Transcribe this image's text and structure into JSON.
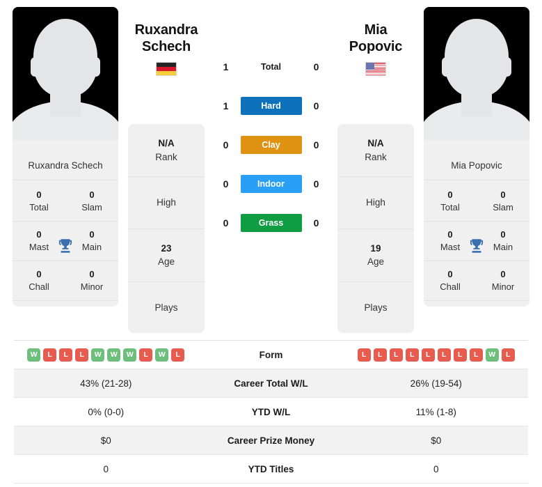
{
  "players": {
    "left": {
      "name": "Ruxandra Schech",
      "first_name": "Ruxandra",
      "last_name": "Schech",
      "country_flag": "germany-flag",
      "rank": "N/A",
      "rank_label": "Rank",
      "high_label": "High",
      "high_value": "",
      "age": "23",
      "age_label": "Age",
      "plays_label": "Plays",
      "plays_value": "",
      "titles": [
        {
          "value": "0",
          "label": "Total"
        },
        {
          "value": "0",
          "label": "Slam"
        },
        {
          "value": "0",
          "label": "Mast"
        },
        {
          "value": "0",
          "label": "Main"
        },
        {
          "value": "0",
          "label": "Chall"
        },
        {
          "value": "0",
          "label": "Minor"
        }
      ],
      "form": [
        "W",
        "L",
        "L",
        "L",
        "W",
        "W",
        "W",
        "L",
        "W",
        "L"
      ],
      "career_total_wl": "43% (21-28)",
      "ytd_wl": "0% (0-0)",
      "career_prize_money": "$0",
      "ytd_titles": "0"
    },
    "right": {
      "name": "Mia Popovic",
      "first_name": "Mia",
      "last_name": "Popovic",
      "country_flag": "usa-flag",
      "rank": "N/A",
      "rank_label": "Rank",
      "high_label": "High",
      "high_value": "",
      "age": "19",
      "age_label": "Age",
      "plays_label": "Plays",
      "plays_value": "",
      "titles": [
        {
          "value": "0",
          "label": "Total"
        },
        {
          "value": "0",
          "label": "Slam"
        },
        {
          "value": "0",
          "label": "Mast"
        },
        {
          "value": "0",
          "label": "Main"
        },
        {
          "value": "0",
          "label": "Chall"
        },
        {
          "value": "0",
          "label": "Minor"
        }
      ],
      "form": [
        "L",
        "L",
        "L",
        "L",
        "L",
        "L",
        "L",
        "L",
        "W",
        "L"
      ],
      "career_total_wl": "26% (19-54)",
      "ytd_wl": "11% (1-8)",
      "career_prize_money": "$0",
      "ytd_titles": "0"
    }
  },
  "surfaces": [
    {
      "label": "Total",
      "left": "1",
      "right": "0",
      "color": "",
      "styled": false
    },
    {
      "label": "Hard",
      "left": "1",
      "right": "0",
      "color": "#0d72bb",
      "styled": true
    },
    {
      "label": "Clay",
      "left": "0",
      "right": "0",
      "color": "#e09213",
      "styled": true
    },
    {
      "label": "Indoor",
      "left": "0",
      "right": "0",
      "color": "#29a0f5",
      "styled": true
    },
    {
      "label": "Grass",
      "left": "0",
      "right": "0",
      "color": "#0f9c43",
      "styled": true
    }
  ],
  "table_rows": [
    {
      "label": "Form",
      "left": "",
      "right": "",
      "type": "form"
    },
    {
      "label": "Career Total W/L",
      "left": "43% (21-28)",
      "right": "26% (19-54)",
      "type": "text"
    },
    {
      "label": "YTD W/L",
      "left": "0% (0-0)",
      "right": "11% (1-8)",
      "type": "text"
    },
    {
      "label": "Career Prize Money",
      "left": "$0",
      "right": "$0",
      "type": "text"
    },
    {
      "label": "YTD Titles",
      "left": "0",
      "right": "0",
      "type": "text"
    }
  ],
  "colors": {
    "hard": "#0d72bb",
    "clay": "#e09213",
    "indoor": "#29a0f5",
    "grass": "#0f9c43",
    "win": "#6dbf7b",
    "loss": "#e85b4f",
    "trophy": "#3c6fad",
    "panel": "#f0f0f0"
  }
}
